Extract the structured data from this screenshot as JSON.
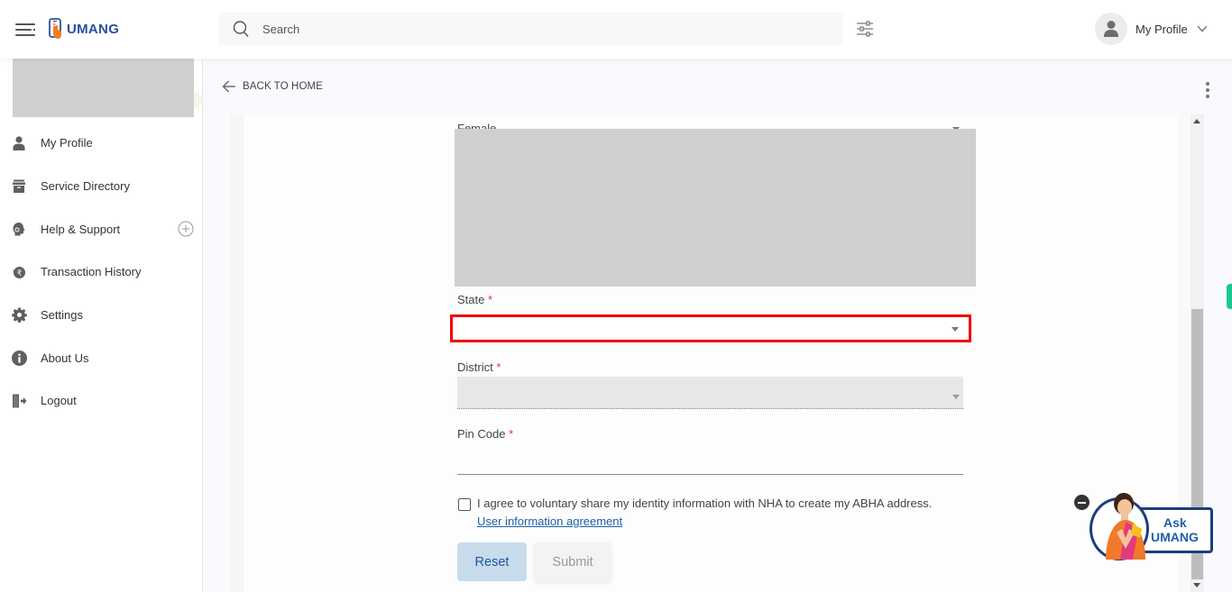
{
  "header": {
    "app_name": "UMANG",
    "search_placeholder": "Search",
    "profile_label": "My Profile"
  },
  "sidebar": {
    "items": [
      {
        "label": "My Profile",
        "icon": "user-icon"
      },
      {
        "label": "Service Directory",
        "icon": "archive-icon"
      },
      {
        "label": "Help & Support",
        "icon": "headset-icon",
        "expandable": true
      },
      {
        "label": "Transaction History",
        "icon": "rupee-history-icon"
      },
      {
        "label": "Settings",
        "icon": "gear-icon"
      },
      {
        "label": "About Us",
        "icon": "info-icon"
      },
      {
        "label": "Logout",
        "icon": "logout-icon"
      }
    ]
  },
  "main": {
    "back_label": "BACK TO HOME",
    "form": {
      "gender_value": "Female",
      "state": {
        "label": "State",
        "required_mark": "*",
        "value": ""
      },
      "district": {
        "label": "District",
        "required_mark": "*",
        "value": "",
        "disabled": true
      },
      "pincode": {
        "label": "Pin Code",
        "required_mark": "*",
        "value": ""
      },
      "consent": {
        "checked": false,
        "text": "I agree to voluntary share my identity information with NHA to create my ABHA address.",
        "link_label": "User information agreement"
      },
      "reset_label": "Reset",
      "submit_label": "Submit"
    }
  },
  "assistant": {
    "line1": "Ask",
    "line2": "UMANG"
  },
  "colors": {
    "brand_blue": "#2b4f9c",
    "brand_orange": "#f47b20",
    "error_red": "#ef0000",
    "link_blue": "#1c5fa8",
    "accent_green": "#1bc98e"
  }
}
